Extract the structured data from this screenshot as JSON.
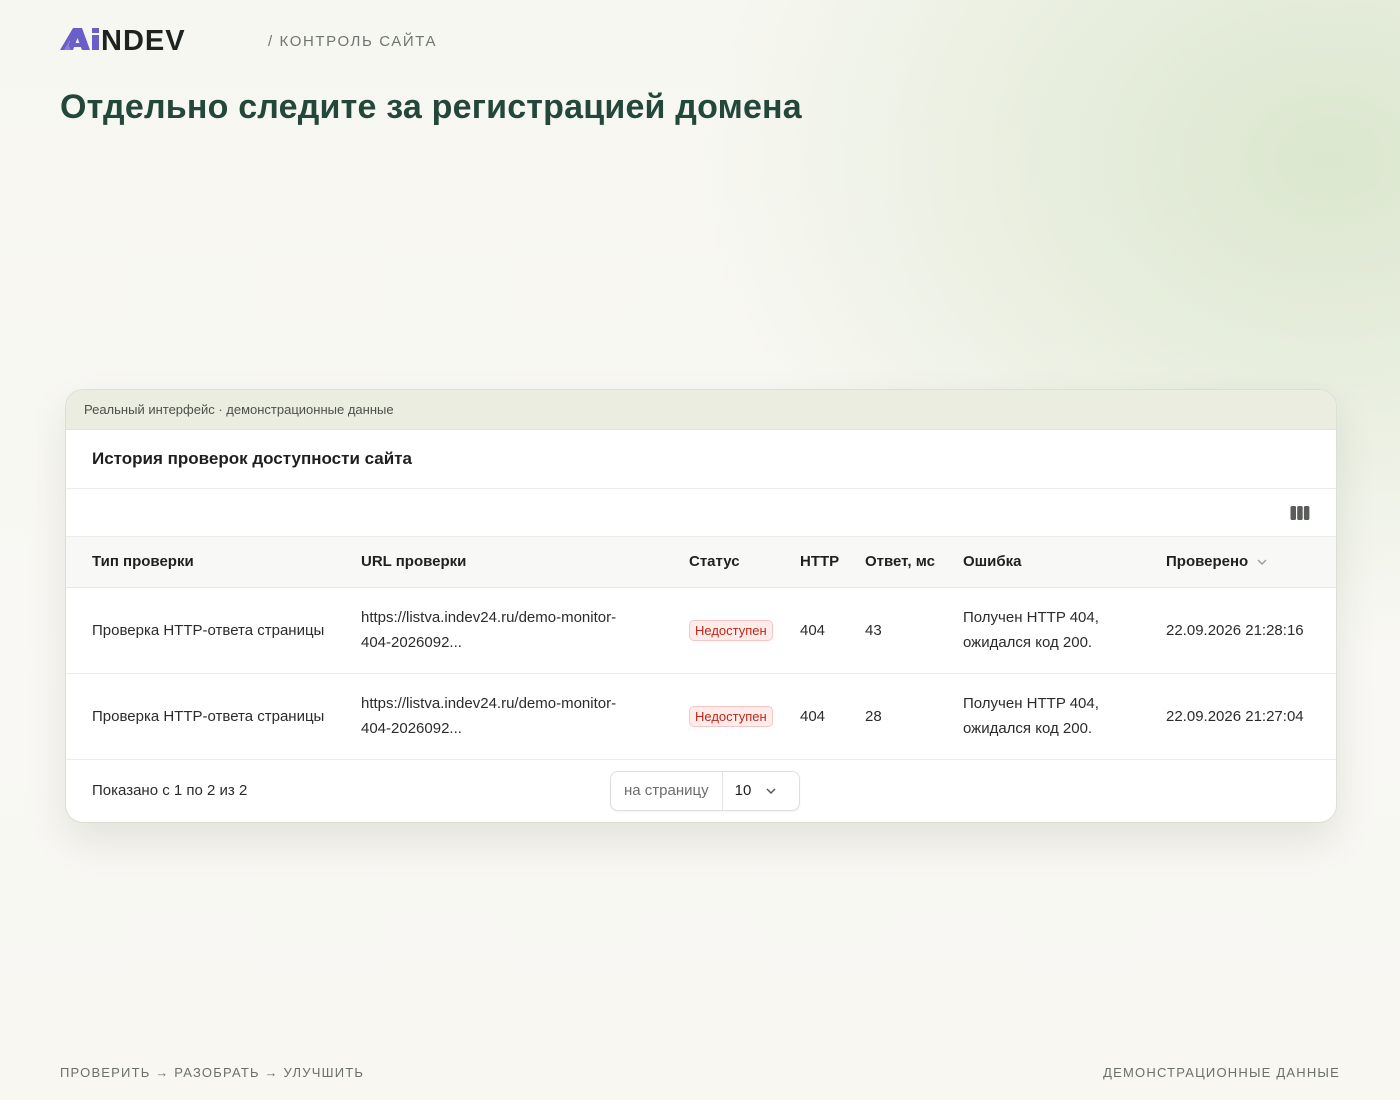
{
  "header": {
    "logo_text": "AiNDEV",
    "breadcrumb": "/ КОНТРОЛЬ САЙТА",
    "title": "Отдельно следите за регистрацией домена"
  },
  "card": {
    "caption": "Реальный интерфейс · демонстрационные данные",
    "panel_title": "История проверок доступности сайта",
    "columns_icon": "columns-icon",
    "table": {
      "headers": [
        "Тип проверки",
        "URL проверки",
        "Статус",
        "HTTP",
        "Ответ, мс",
        "Ошибка",
        "Проверено"
      ],
      "sort_icon": "chevron-down-icon",
      "rows": [
        {
          "type": "Проверка HTTP-ответа страницы",
          "url_line1": "https://listva.indev24.ru/demo-monitor-",
          "url_line2": "404-2026092...",
          "status": "Недоступен",
          "http": "404",
          "response_ms": "43",
          "error_line1": "Получен HTTP 404,",
          "error_line2": "ожидался код 200.",
          "checked": "22.09.2026 21:28:16"
        },
        {
          "type": "Проверка HTTP-ответа страницы",
          "url_line1": "https://listva.indev24.ru/demo-monitor-",
          "url_line2": "404-2026092...",
          "status": "Недоступен",
          "http": "404",
          "response_ms": "28",
          "error_line1": "Получен HTTP 404,",
          "error_line2": "ожидался код 200.",
          "checked": "22.09.2026 21:27:04"
        }
      ]
    },
    "footer": {
      "shown": "Показано с 1 по 2 из 2",
      "per_page_label": "на страницу",
      "per_page_value": "10"
    }
  },
  "bottom": {
    "left": "ПРОВЕРИТЬ → РАЗОБРАТЬ → УЛУЧШИТЬ",
    "right": "ДЕМОНСТРАЦИОННЫЕ ДАННЫЕ"
  },
  "colors": {
    "title": "#23473a",
    "logo_accent": "#6a5fc8",
    "logo_dark": "#1f2320",
    "badge_text": "#c0271b",
    "badge_bg": "#fdecea"
  }
}
